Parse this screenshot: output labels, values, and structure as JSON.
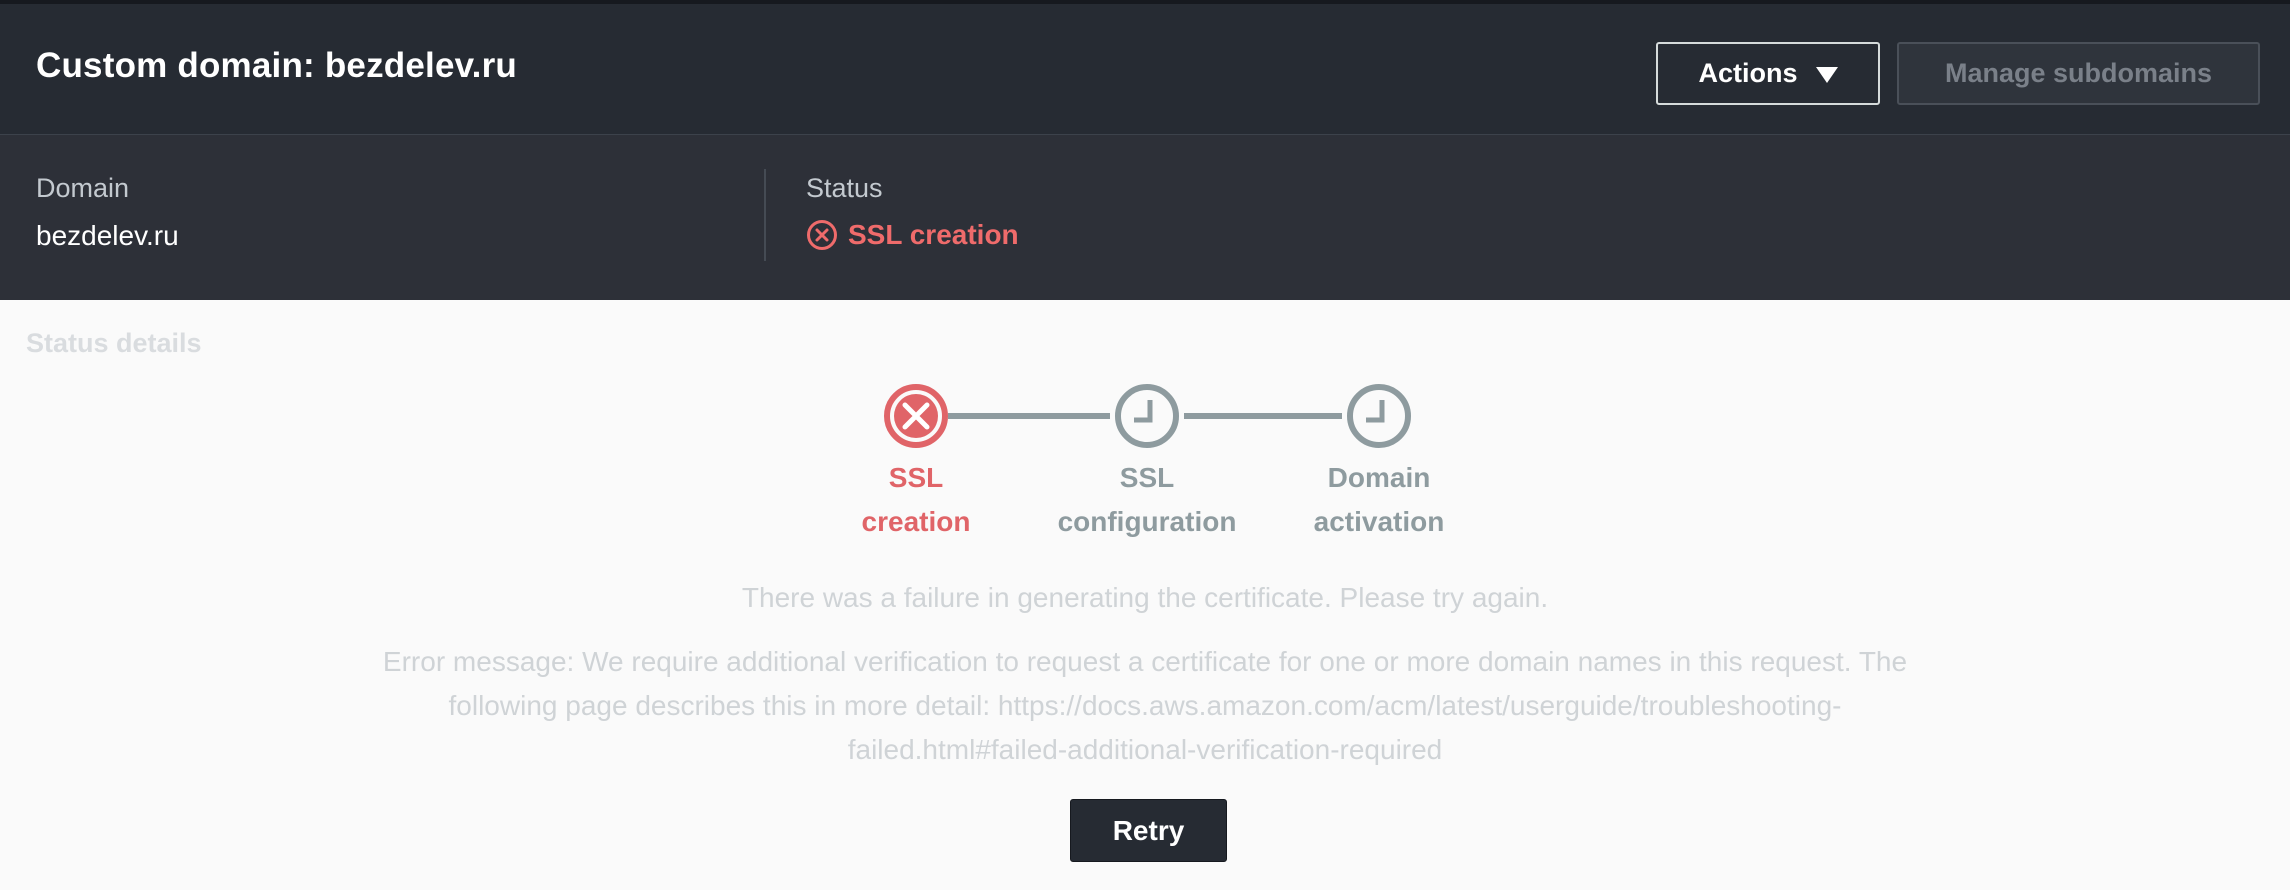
{
  "header": {
    "title": "Custom domain: bezdelev.ru",
    "actions_label": "Actions",
    "manage_label": "Manage subdomains"
  },
  "summary": {
    "domain_label": "Domain",
    "domain_value": "bezdelev.ru",
    "status_label": "Status",
    "status_value": "SSL creation",
    "status_icon": "x-circle-icon"
  },
  "details": {
    "title": "Status details",
    "steps": [
      {
        "line1": "SSL",
        "line2": "creation",
        "state": "error"
      },
      {
        "line1": "SSL",
        "line2": "configuration",
        "state": "pending"
      },
      {
        "line1": "Domain",
        "line2": "activation",
        "state": "pending"
      }
    ],
    "failure_message": "There was a failure in generating the certificate. Please try again.",
    "error_message": "Error message: We require additional verification to request a certificate for one or more domain names in this request. The following page describes this in more detail: https://docs.aws.amazon.com/acm/latest/userguide/troubleshooting-failed.html#failed-additional-verification-required",
    "retry_label": "Retry"
  },
  "colors": {
    "error": "#e06468",
    "pending": "#8e9b9f",
    "header_bg": "#262b33"
  }
}
